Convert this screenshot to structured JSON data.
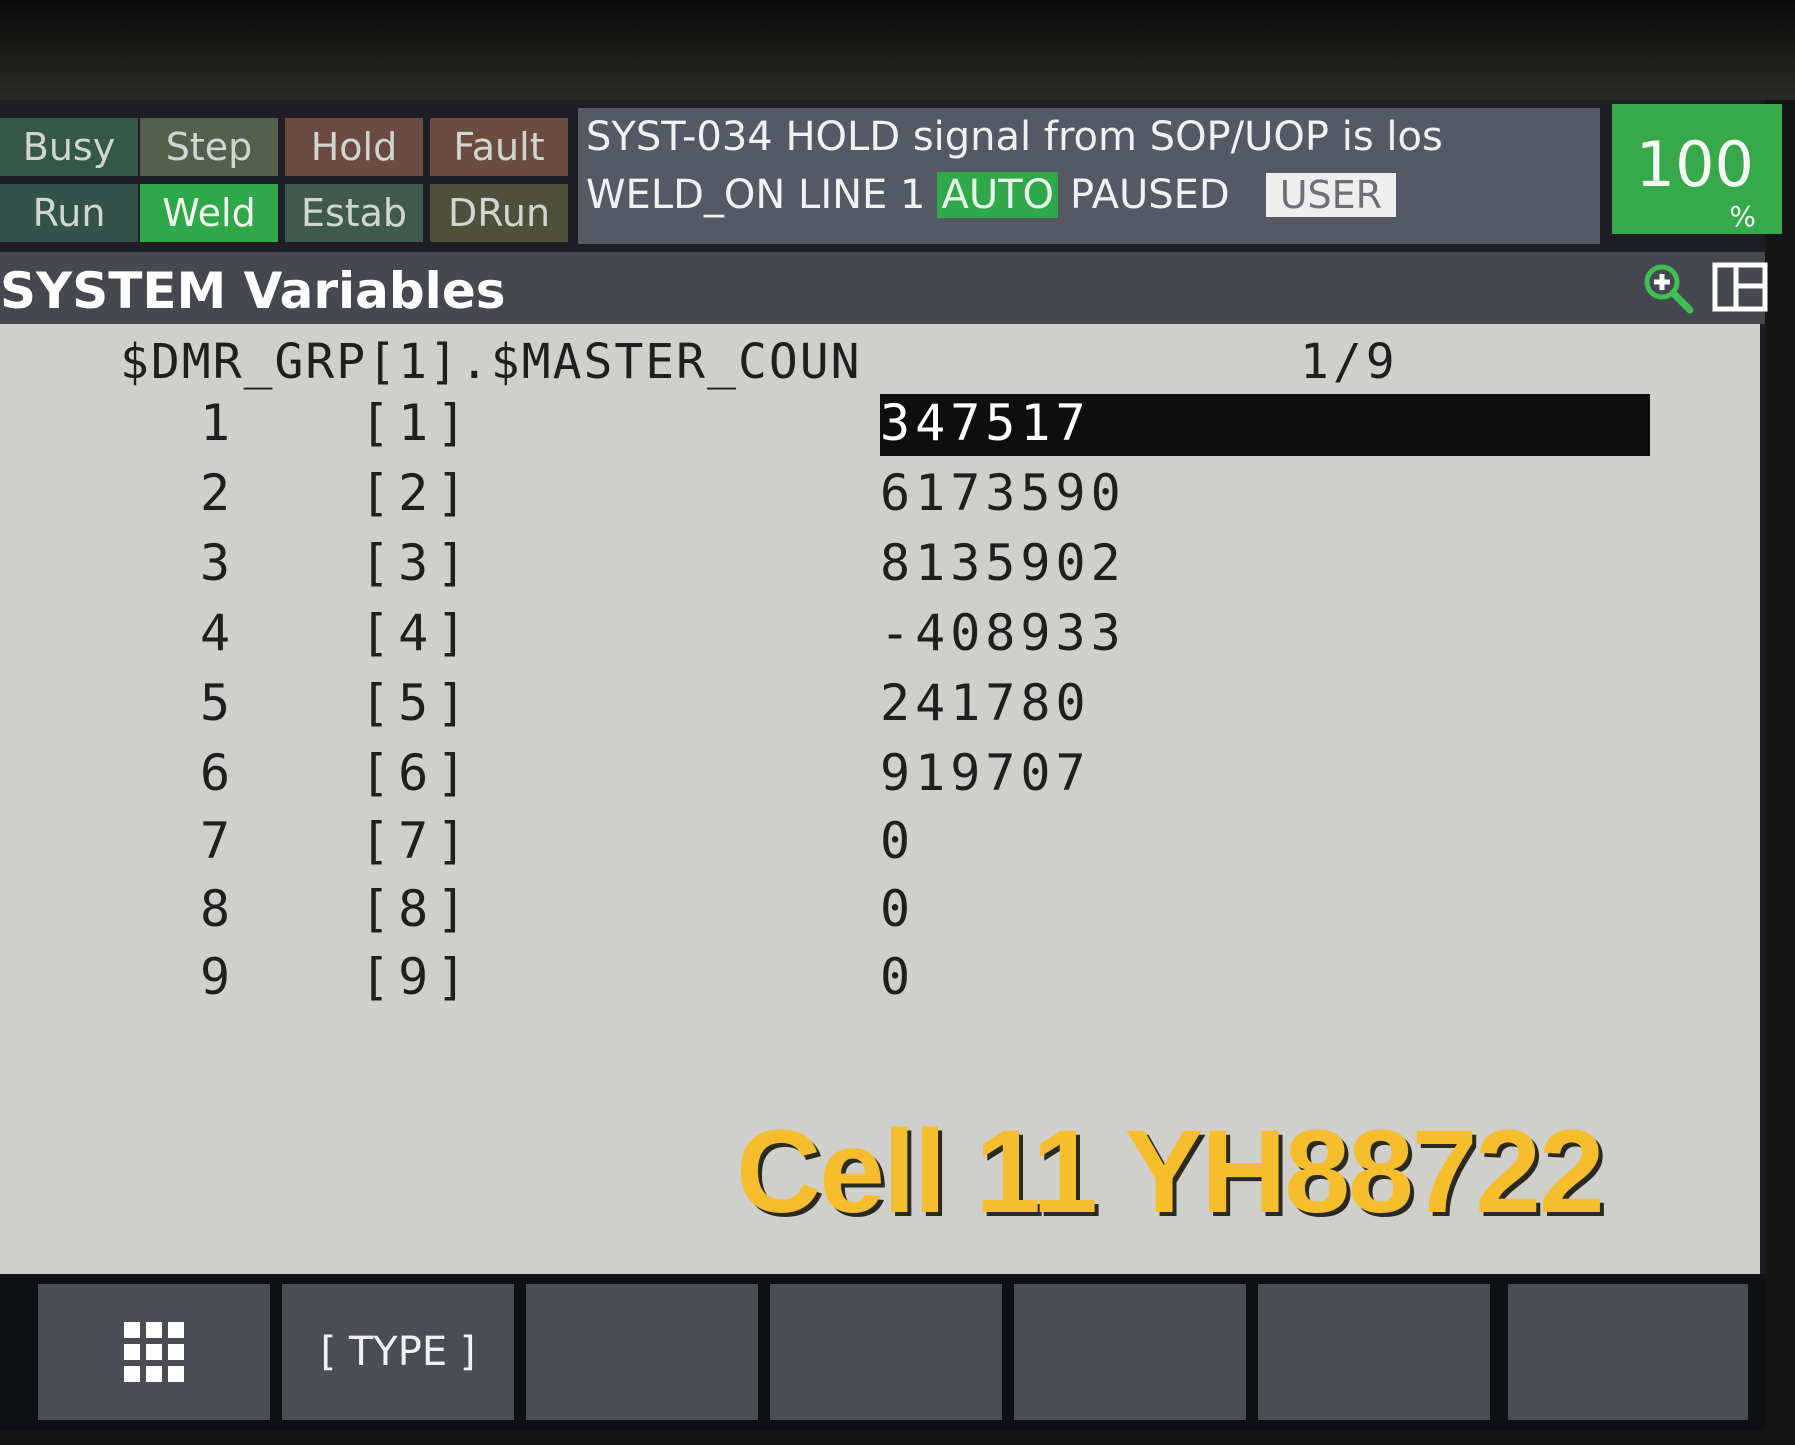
{
  "status_buttons": {
    "busy": "Busy",
    "step": "Step",
    "hold": "Hold",
    "fault": "Fault",
    "run": "Run",
    "weld": "Weld",
    "estab": "Estab",
    "drun": "DRun"
  },
  "message": {
    "line1": "SYST-034 HOLD signal from SOP/UOP is los",
    "program": "WELD_ON LINE 1",
    "mode": "AUTO",
    "state": "PAUSED",
    "user": "USER"
  },
  "override": {
    "value": "100",
    "unit": "%"
  },
  "title": "SYSTEM Variables",
  "icons": {
    "zoom": "zoom-in-icon",
    "layout": "split-layout-icon",
    "menu": "grid-menu-icon"
  },
  "variable": {
    "name": "$DMR_GRP[1].$MASTER_COUN",
    "page": "1/9",
    "rows": [
      {
        "index": "1",
        "label": "[1]",
        "value": "347517"
      },
      {
        "index": "2",
        "label": "[2]",
        "value": "6173590"
      },
      {
        "index": "3",
        "label": "[3]",
        "value": "8135902"
      },
      {
        "index": "4",
        "label": "[4]",
        "value": "-408933"
      },
      {
        "index": "5",
        "label": "[5]",
        "value": "241780"
      },
      {
        "index": "6",
        "label": "[6]",
        "value": "919707"
      },
      {
        "index": "7",
        "label": "[7]",
        "value": "0"
      },
      {
        "index": "8",
        "label": "[8]",
        "value": "0"
      },
      {
        "index": "9",
        "label": "[9]",
        "value": "0"
      }
    ]
  },
  "watermark": "Cell 11 YH88722",
  "function_keys": {
    "type": "[ TYPE ]"
  },
  "colors": {
    "accent_green": "#2fa84a",
    "status_bar": "#555966",
    "content_bg": "#cfcfcb",
    "watermark": "#f6bd2c"
  }
}
